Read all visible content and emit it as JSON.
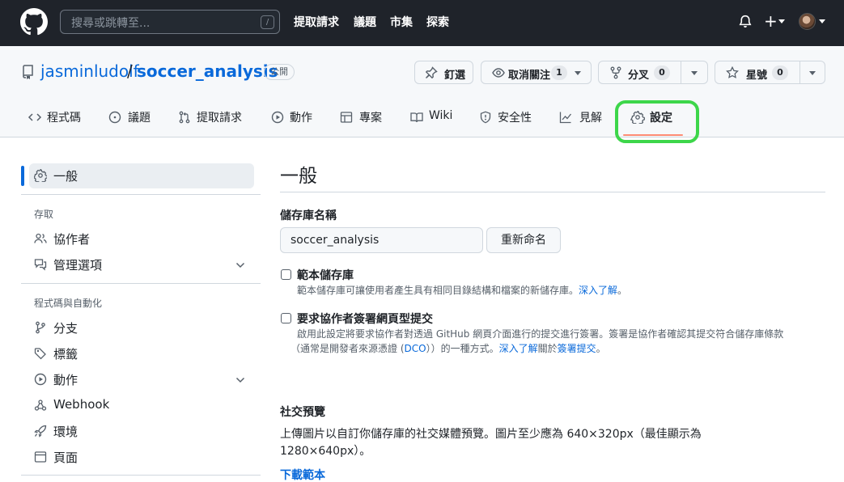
{
  "header": {
    "search_placeholder": "搜尋或跳轉至...",
    "search_shortcut": "/",
    "nav": [
      "提取請求",
      "議題",
      "市集",
      "探索"
    ],
    "plus_label": "+"
  },
  "repo": {
    "owner": "jasminludolf",
    "separator": "/",
    "name": "soccer_analysis",
    "visibility": "公開",
    "pin_label": "釘選",
    "watch_label": "取消關注",
    "watch_count": "1",
    "fork_label": "分叉",
    "fork_count": "0",
    "star_label": "星號",
    "star_count": "0"
  },
  "tabs": [
    {
      "label": "程式碼",
      "icon": "code-icon"
    },
    {
      "label": "議題",
      "icon": "issue-icon"
    },
    {
      "label": "提取請求",
      "icon": "pull-request-icon"
    },
    {
      "label": "動作",
      "icon": "play-icon"
    },
    {
      "label": "專案",
      "icon": "table-icon"
    },
    {
      "label": "Wiki",
      "icon": "book-icon"
    },
    {
      "label": "安全性",
      "icon": "shield-icon"
    },
    {
      "label": "見解",
      "icon": "graph-icon"
    },
    {
      "label": "設定",
      "icon": "gear-icon",
      "selected": true
    }
  ],
  "sidebar": {
    "general": "一般",
    "access_heading": "存取",
    "collaborators": "協作者",
    "moderation": "管理選項",
    "code_heading": "程式碼與自動化",
    "branches": "分支",
    "tags": "標籤",
    "actions": "動作",
    "webhooks": "Webhook",
    "environments": "環境",
    "pages": "頁面"
  },
  "main": {
    "title": "一般",
    "repo_name_label": "儲存庫名稱",
    "repo_name_value": "soccer_analysis",
    "rename_button": "重新命名",
    "template_label": "範本儲存庫",
    "template_desc": "範本儲存庫可讓使用者產生具有相同目錄結構和檔案的新儲存庫。",
    "template_link": "深入了解",
    "template_end": "。",
    "signoff_label": "要求協作者簽署網頁型提交",
    "signoff_desc1": "啟用此設定將要求協作者對透過 GitHub 網頁介面進行的提交進行簽署。簽署是協作者確認其提交符合儲存庫條款",
    "signoff_desc2a": "（通常是開發者來源憑證 (",
    "signoff_dco": "DCO",
    "signoff_desc2b": "））的一種方式。",
    "signoff_link1": "深入了解",
    "signoff_mid": "關於",
    "signoff_link2": "簽署提交",
    "signoff_end": "。",
    "social_title": "社交預覽",
    "social_line1": "上傳圖片以自訂你儲存庫的社交媒體預覽。圖片至少應為 640×320px（最佳顯示為",
    "social_line2": "1280×640px）。",
    "download_template": "下載範本"
  },
  "colors": {
    "header_bg": "#1f232a",
    "link": "#0969da",
    "tab_underline": "#fd8c73",
    "annotation_highlight": "#3dd64a"
  }
}
